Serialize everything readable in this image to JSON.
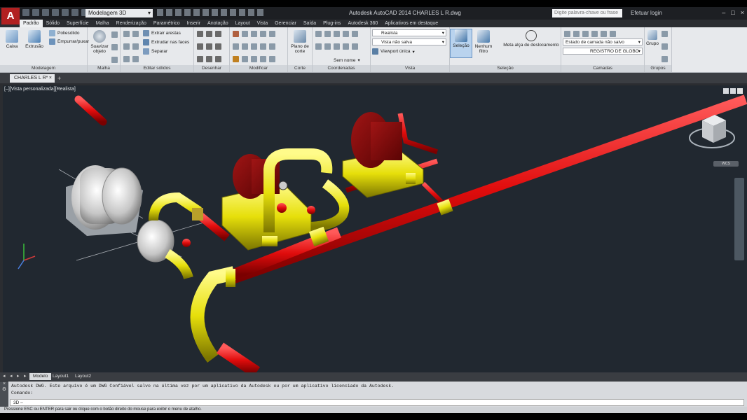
{
  "app": {
    "logo_letter": "A",
    "workspace": "Modelagem 3D",
    "window_title": "Autodesk AutoCAD 2014    CHARLES L R.dwg",
    "search_placeholder": "Digite palavra-chave ou frase",
    "sign_in": "Efetuar login"
  },
  "ribbon_tabs": [
    "Padrão",
    "Sólido",
    "Superfície",
    "Malha",
    "Renderização",
    "Paramétrico",
    "Inserir",
    "Anotação",
    "Layout",
    "Vista",
    "Gerenciar",
    "Saída",
    "Plug-ins",
    "Autodesk 360",
    "Aplicativos em destaque"
  ],
  "ribbon": {
    "modelagem": {
      "title": "Modelagem",
      "caixa": "Caixa",
      "extrusao": "Extrusão",
      "poliesolido": "Poliesólido",
      "empurrar": "Empurrar/puxar"
    },
    "malha": {
      "title": "Malha",
      "suavizar": "Suavizar objeto"
    },
    "editar_solidos": {
      "title": "Editar sólidos",
      "extrair": "Extrair arestas",
      "extrudar": "Extrudar nas faces",
      "separar": "Separar"
    },
    "desenhar": {
      "title": "Desenhar"
    },
    "modificar": {
      "title": "Modificar"
    },
    "corte": {
      "title": "Corte",
      "plano": "Plano de corte"
    },
    "coordenadas": {
      "title": "Coordenadas",
      "sem_nome": "Sem nome"
    },
    "vista": {
      "title": "Vista",
      "estilo": "Realista",
      "tipo": "Vista não salva",
      "viewport": "Viewport única"
    },
    "selecao": {
      "title": "Seleção",
      "selecao": "Seleção",
      "nenhum_filtro": "Nenhum filtro",
      "meta_alca": "Meta alça de deslocamento"
    },
    "camadas": {
      "title": "Camadas",
      "estado": "Estado de camada não salvo",
      "camada": "REGISTRO DE GLOBO"
    },
    "grupos": {
      "title": "Grupos",
      "grupo": "Grupo"
    }
  },
  "document_tab": "CHARLES L R*",
  "viewport": {
    "label": "[–][Vista personalizada][Realista]",
    "wcs": "WCS"
  },
  "bottom_tabs": [
    "Modelo",
    "Layout1",
    "Layout2"
  ],
  "command": {
    "line1": "Autodesk DWG. Este arquivo é um DWG Confiável salvo na última vez por um aplicativo da Autodesk ou por um aplicativo licenciado da Autodesk.",
    "line2": "Comando:",
    "input_prefix": "3D –"
  },
  "status_text": "Pressione ESC ou ENTER para sair ou clique com o botão direito do mouse para exibir o menu de atalho.",
  "colors": {
    "pipe_red": "#e01010",
    "fitting_yellow": "#e6e00a",
    "pump_gray": "#c8c8c8",
    "background": "#212830"
  }
}
